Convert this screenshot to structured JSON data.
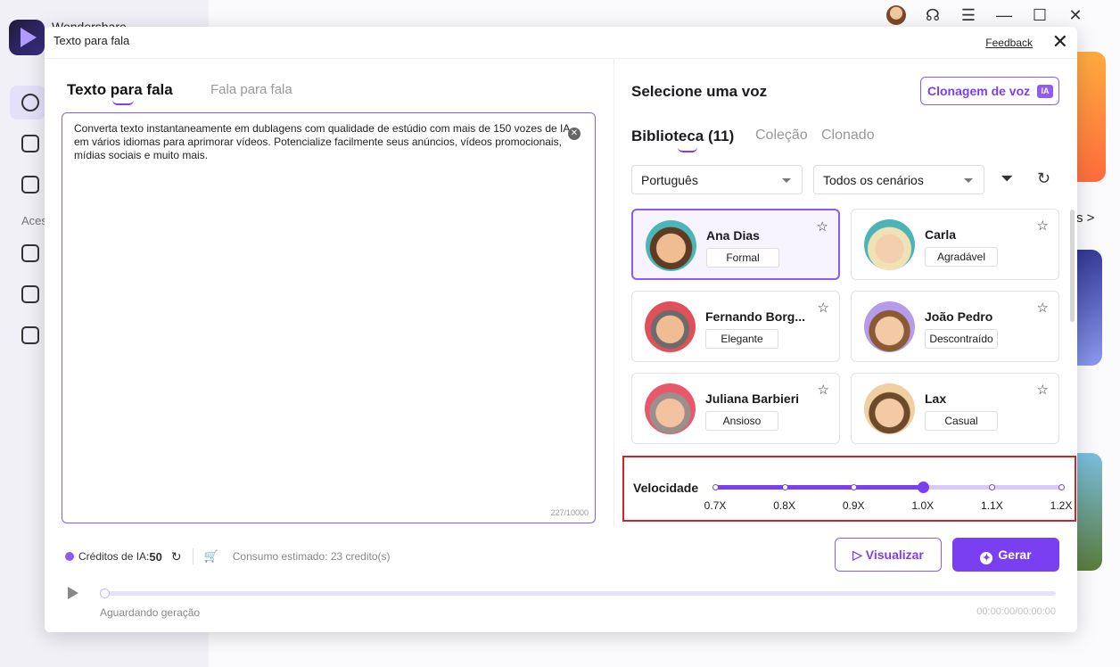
{
  "app": {
    "name": "Wondershare"
  },
  "modal": {
    "title": "Texto para fala",
    "feedback": "Feedback"
  },
  "side": {
    "section_label": "Aces"
  },
  "peek": {
    "link_text": "s >"
  },
  "editor": {
    "tabs": [
      "Texto para fala",
      "Fala para fala"
    ],
    "text": "Converta texto instantaneamente em dublagens com qualidade de estúdio com mais de 150 vozes de IA em vários idiomas para aprimorar vídeos. Potencialize facilmente seus anúncios, vídeos promocionais, mídias sociais e muito mais.",
    "counter": "227/10000"
  },
  "voice_panel": {
    "title": "Selecione uma voz",
    "clone_button": "Clonagem de voz",
    "ia_badge": "IA",
    "tabs": [
      "Biblioteca (11)",
      "Coleção",
      "Clonado"
    ],
    "language": "Português",
    "scenario": "Todos os cenários",
    "voices": [
      {
        "name": "Ana Dias",
        "tag": "Formal",
        "selected": true
      },
      {
        "name": "Carla",
        "tag": "Agradável",
        "selected": false
      },
      {
        "name": "Fernando Borg...",
        "tag": "Elegante",
        "selected": false
      },
      {
        "name": "João Pedro",
        "tag": "Descontraído",
        "selected": false
      },
      {
        "name": "Juliana Barbieri",
        "tag": "Ansioso",
        "selected": false
      },
      {
        "name": "Lax",
        "tag": "Casual",
        "selected": false
      }
    ]
  },
  "speed": {
    "label": "Velocidade",
    "ticks": [
      "0.7X",
      "0.8X",
      "0.9X",
      "1.0X",
      "1.1X",
      "1.2X"
    ],
    "selected": "1.0X"
  },
  "footer": {
    "credits_label": "Créditos de IA:",
    "credits_value": "50",
    "consumo": "Consumo estimado: 23 credito(s)",
    "preview_button": "Visualizar",
    "generate_button": "Gerar"
  },
  "player": {
    "status": "Aguardando geração",
    "time": "00:00:00/00:00:00",
    "progress": 0
  },
  "colors": {
    "accent": "#7b3ff2",
    "highlight_border": "#d0232a"
  }
}
